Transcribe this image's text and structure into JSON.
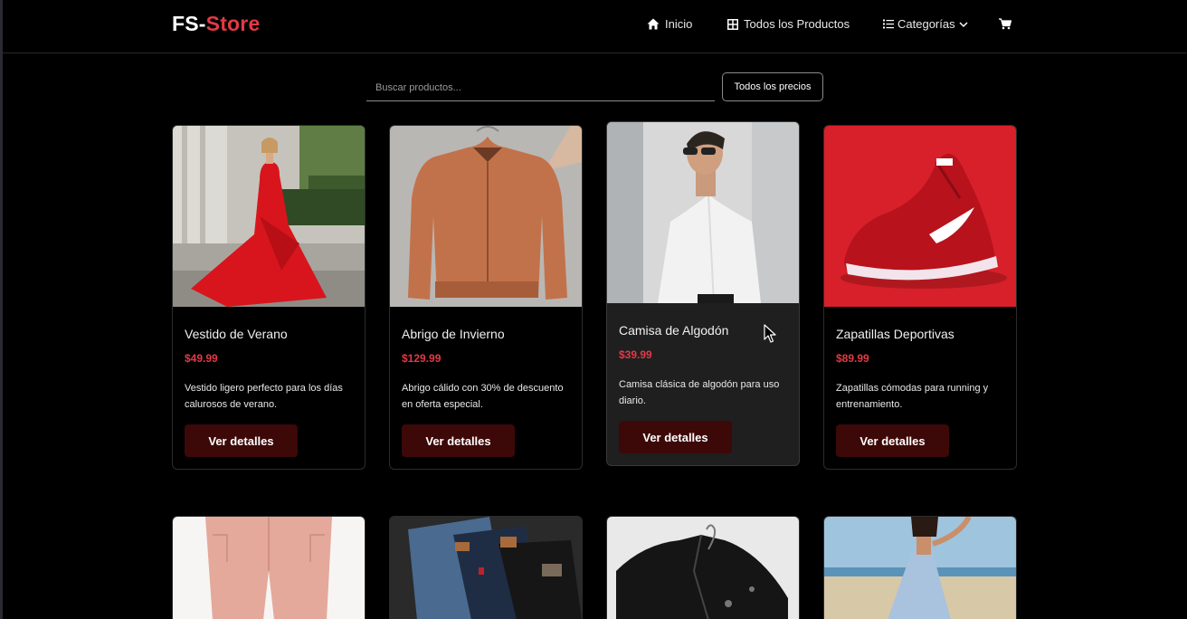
{
  "brand": {
    "part1": "FS-",
    "part2": "Store"
  },
  "nav": {
    "home": "Inicio",
    "all_products": "Todos los Productos",
    "categories": "Categorías"
  },
  "search": {
    "placeholder": "Buscar productos...",
    "value": ""
  },
  "price_filter": {
    "label": "Todos los precios"
  },
  "products": [
    {
      "title": "Vestido de Verano",
      "price": "$49.99",
      "description": "Vestido ligero perfecto para los días calurosos de verano.",
      "button": "Ver detalles"
    },
    {
      "title": "Abrigo de Invierno",
      "price": "$129.99",
      "description": "Abrigo cálido con 30% de descuento en oferta especial.",
      "button": "Ver detalles"
    },
    {
      "title": "Camisa de Algodón",
      "price": "$39.99",
      "description": "Camisa clásica de algodón para uso diario.",
      "button": "Ver detalles"
    },
    {
      "title": "Zapatillas Deportivas",
      "price": "$89.99",
      "description": "Zapatillas cómodas para running y entrenamiento.",
      "button": "Ver detalles"
    }
  ],
  "colors": {
    "accent": "#e23a45",
    "button_bg": "#3d0808",
    "card_hover_bg": "#1f1f1f"
  },
  "icons": [
    "home-icon",
    "grid-icon",
    "list-icon",
    "chevron-down-icon",
    "cart-icon"
  ]
}
